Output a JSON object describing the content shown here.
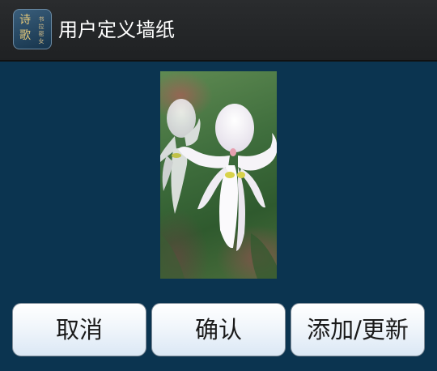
{
  "action_bar": {
    "title": "用户定义墙纸",
    "app_icon": {
      "main_chars": "诗歌",
      "sub_chars": "书拉密女"
    }
  },
  "preview": {
    "image_description_icon": "orchid-flower-photo"
  },
  "buttons": {
    "cancel_label": "取消",
    "confirm_label": "确认",
    "add_update_label": "添加/更新"
  },
  "colors": {
    "background": "#0b3450",
    "action_bar": "#2a2c2e",
    "title_text": "#ffffff",
    "button_text": "#1a1a1a"
  }
}
